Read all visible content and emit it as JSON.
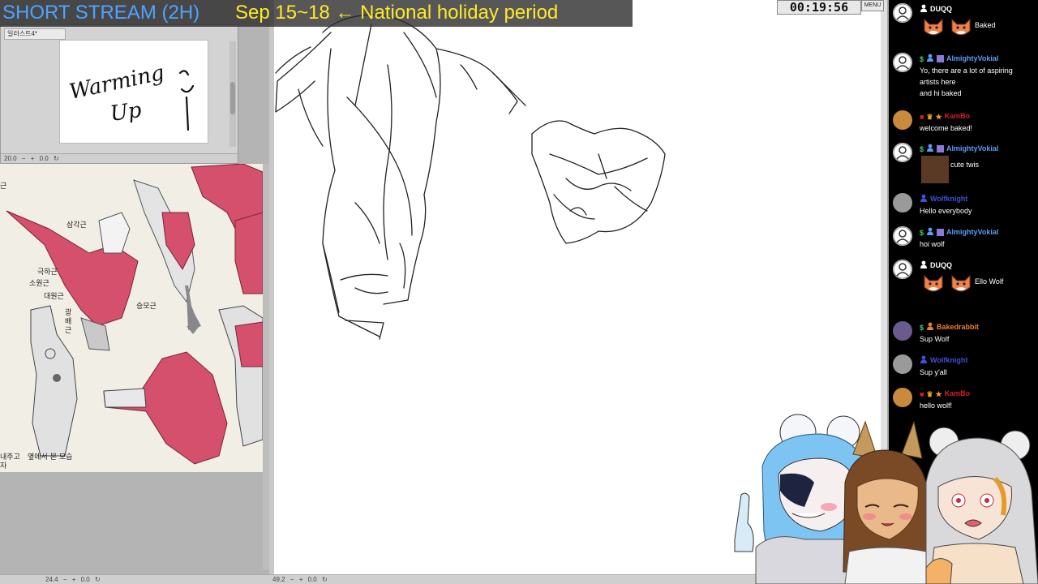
{
  "overlay": {
    "stream_title": "SHORT STREAM (2H)",
    "holiday_notice": "Sep 15~18 ← National holiday period",
    "timer": "00:19:56",
    "menu_label": "MENU"
  },
  "navigator": {
    "tab_label": "일러스트4*",
    "preview_text_line1": "Warming",
    "preview_text_line2": "Up",
    "zoom_value": "20.0",
    "angle_value": "0.0"
  },
  "reference": {
    "labels": {
      "deltoid": "삼각근",
      "pec_minor": "극하근",
      "teres_minor": "소원근",
      "teres_major": "대원근",
      "lats": "광\n배\n근",
      "trapezius": "승모근",
      "caption": "옆에서 본 모습",
      "caption_left": "내주고\n자",
      "corner_label": "근"
    },
    "zoom_value": "24.4",
    "angle_value": "0.0"
  },
  "canvas": {
    "zoom_value": "49.2",
    "angle_value": "0.0"
  },
  "chat": {
    "messages": [
      {
        "user": "DUQQ",
        "color": "#ffffff",
        "avatar": "white",
        "text": "Baked",
        "emotes": 2
      },
      {
        "user": "AlmightyVokial",
        "color": "#5b9cf6",
        "avatar": "white",
        "text": "Yo, there are a lot of aspiring artists here\nand hi baked"
      },
      {
        "user": "KamBo",
        "color": "#d21f2a",
        "avatar": "orange",
        "text": "welcome baked!"
      },
      {
        "user": "AlmightyVokial",
        "color": "#5b9cf6",
        "avatar": "white",
        "text": "cute twis"
      },
      {
        "user": "Wolfknight",
        "color": "#3b52d9",
        "avatar": "grey",
        "text": "Hello everybody"
      },
      {
        "user": "AlmightyVokial",
        "color": "#5b9cf6",
        "avatar": "white",
        "text": "hoi wolf"
      },
      {
        "user": "DUQQ",
        "color": "#ffffff",
        "avatar": "white",
        "text": "Ello Wolf",
        "emotes": 2
      },
      {
        "user": "Bakedrabbit",
        "color": "#e8812b",
        "avatar": "purple",
        "text": "Sup Wolf"
      },
      {
        "user": "Wolfknight",
        "color": "#3b52d9",
        "avatar": "grey",
        "text": "Sup y'all"
      },
      {
        "user": "KamBo",
        "color": "#d21f2a",
        "avatar": "orange",
        "text": "hello wolf!"
      }
    ]
  },
  "colors": {
    "banner_blue": "#4fa3ff",
    "banner_yellow": "#ffe92a",
    "muscle_red": "#d4506c",
    "chat_bg": "#000000"
  }
}
